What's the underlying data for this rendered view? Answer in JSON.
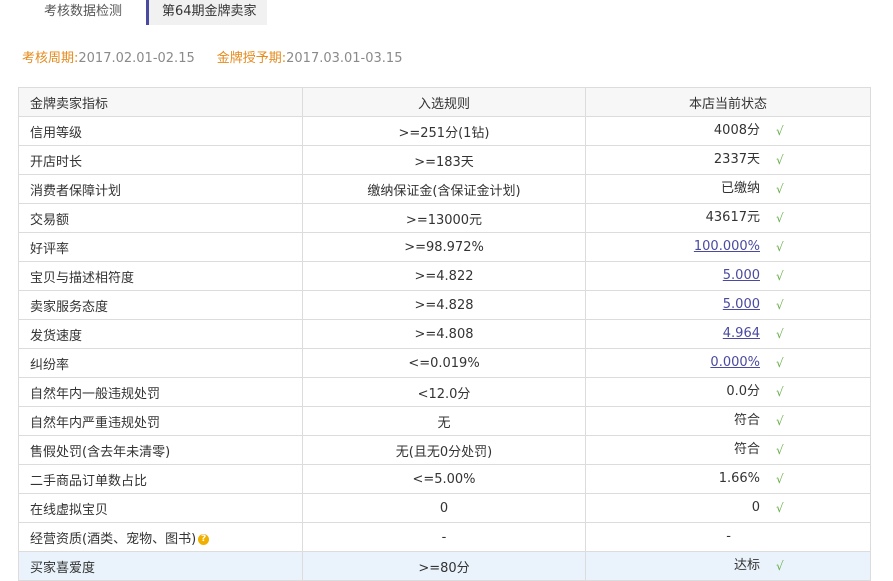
{
  "tabs": [
    {
      "label": "考核数据检测"
    },
    {
      "label": "第64期金牌卖家"
    }
  ],
  "period": {
    "assess_label": "考核周期:",
    "assess_value": "2017.02.01-02.15",
    "grant_label": "金牌授予期:",
    "grant_value": "2017.03.01-03.15"
  },
  "table": {
    "headers": [
      "金牌卖家指标",
      "入选规则",
      "本店当前状态"
    ],
    "rows": [
      {
        "indicator": "信用等级",
        "rule": ">=251分(1钻)",
        "status": "4008分",
        "link": false,
        "check": "√"
      },
      {
        "indicator": "开店时长",
        "rule": ">=183天",
        "status": "2337天",
        "link": false,
        "check": "√"
      },
      {
        "indicator": "消费者保障计划",
        "rule": "缴纳保证金(含保证金计划)",
        "status": "已缴纳",
        "link": false,
        "check": "√"
      },
      {
        "indicator": "交易额",
        "rule": ">=13000元",
        "status": "43617元",
        "link": false,
        "check": "√"
      },
      {
        "indicator": "好评率",
        "rule": ">=98.972%",
        "status": "100.000%",
        "link": true,
        "check": "√"
      },
      {
        "indicator": "宝贝与描述相符度",
        "rule": ">=4.822",
        "status": "5.000",
        "link": true,
        "check": "√"
      },
      {
        "indicator": "卖家服务态度",
        "rule": ">=4.828",
        "status": "5.000",
        "link": true,
        "check": "√"
      },
      {
        "indicator": "发货速度",
        "rule": ">=4.808",
        "status": "4.964",
        "link": true,
        "check": "√"
      },
      {
        "indicator": "纠纷率",
        "rule": "<=0.019%",
        "status": "0.000%",
        "link": true,
        "check": "√"
      },
      {
        "indicator": "自然年内一般违规处罚",
        "rule": "<12.0分",
        "status": "0.0分",
        "link": false,
        "check": "√"
      },
      {
        "indicator": "自然年内严重违规处罚",
        "rule": "无",
        "status": "符合",
        "link": false,
        "check": "√"
      },
      {
        "indicator": "售假处罚(含去年未清零)",
        "rule": "无(且无0分处罚)",
        "status": "符合",
        "link": false,
        "check": "√"
      },
      {
        "indicator": "二手商品订单数占比",
        "rule": "<=5.00%",
        "status": "1.66%",
        "link": false,
        "check": "√"
      },
      {
        "indicator": "在线虚拟宝贝",
        "rule": "0",
        "status": "0",
        "link": false,
        "check": "√"
      },
      {
        "indicator": "经营资质(酒类、宠物、图书)",
        "rule": "-",
        "status": "-",
        "link": false,
        "check": "",
        "help": "?"
      },
      {
        "indicator": "买家喜爱度",
        "rule": ">=80分",
        "status": "达标",
        "link": false,
        "check": "√",
        "highlight": true
      }
    ]
  },
  "colors": {
    "accent": "#e58a1c",
    "link": "#4a4aa0",
    "check": "#6ab04c",
    "help_icon": "#f0b000",
    "highlight_row": "#eaf3fb"
  }
}
